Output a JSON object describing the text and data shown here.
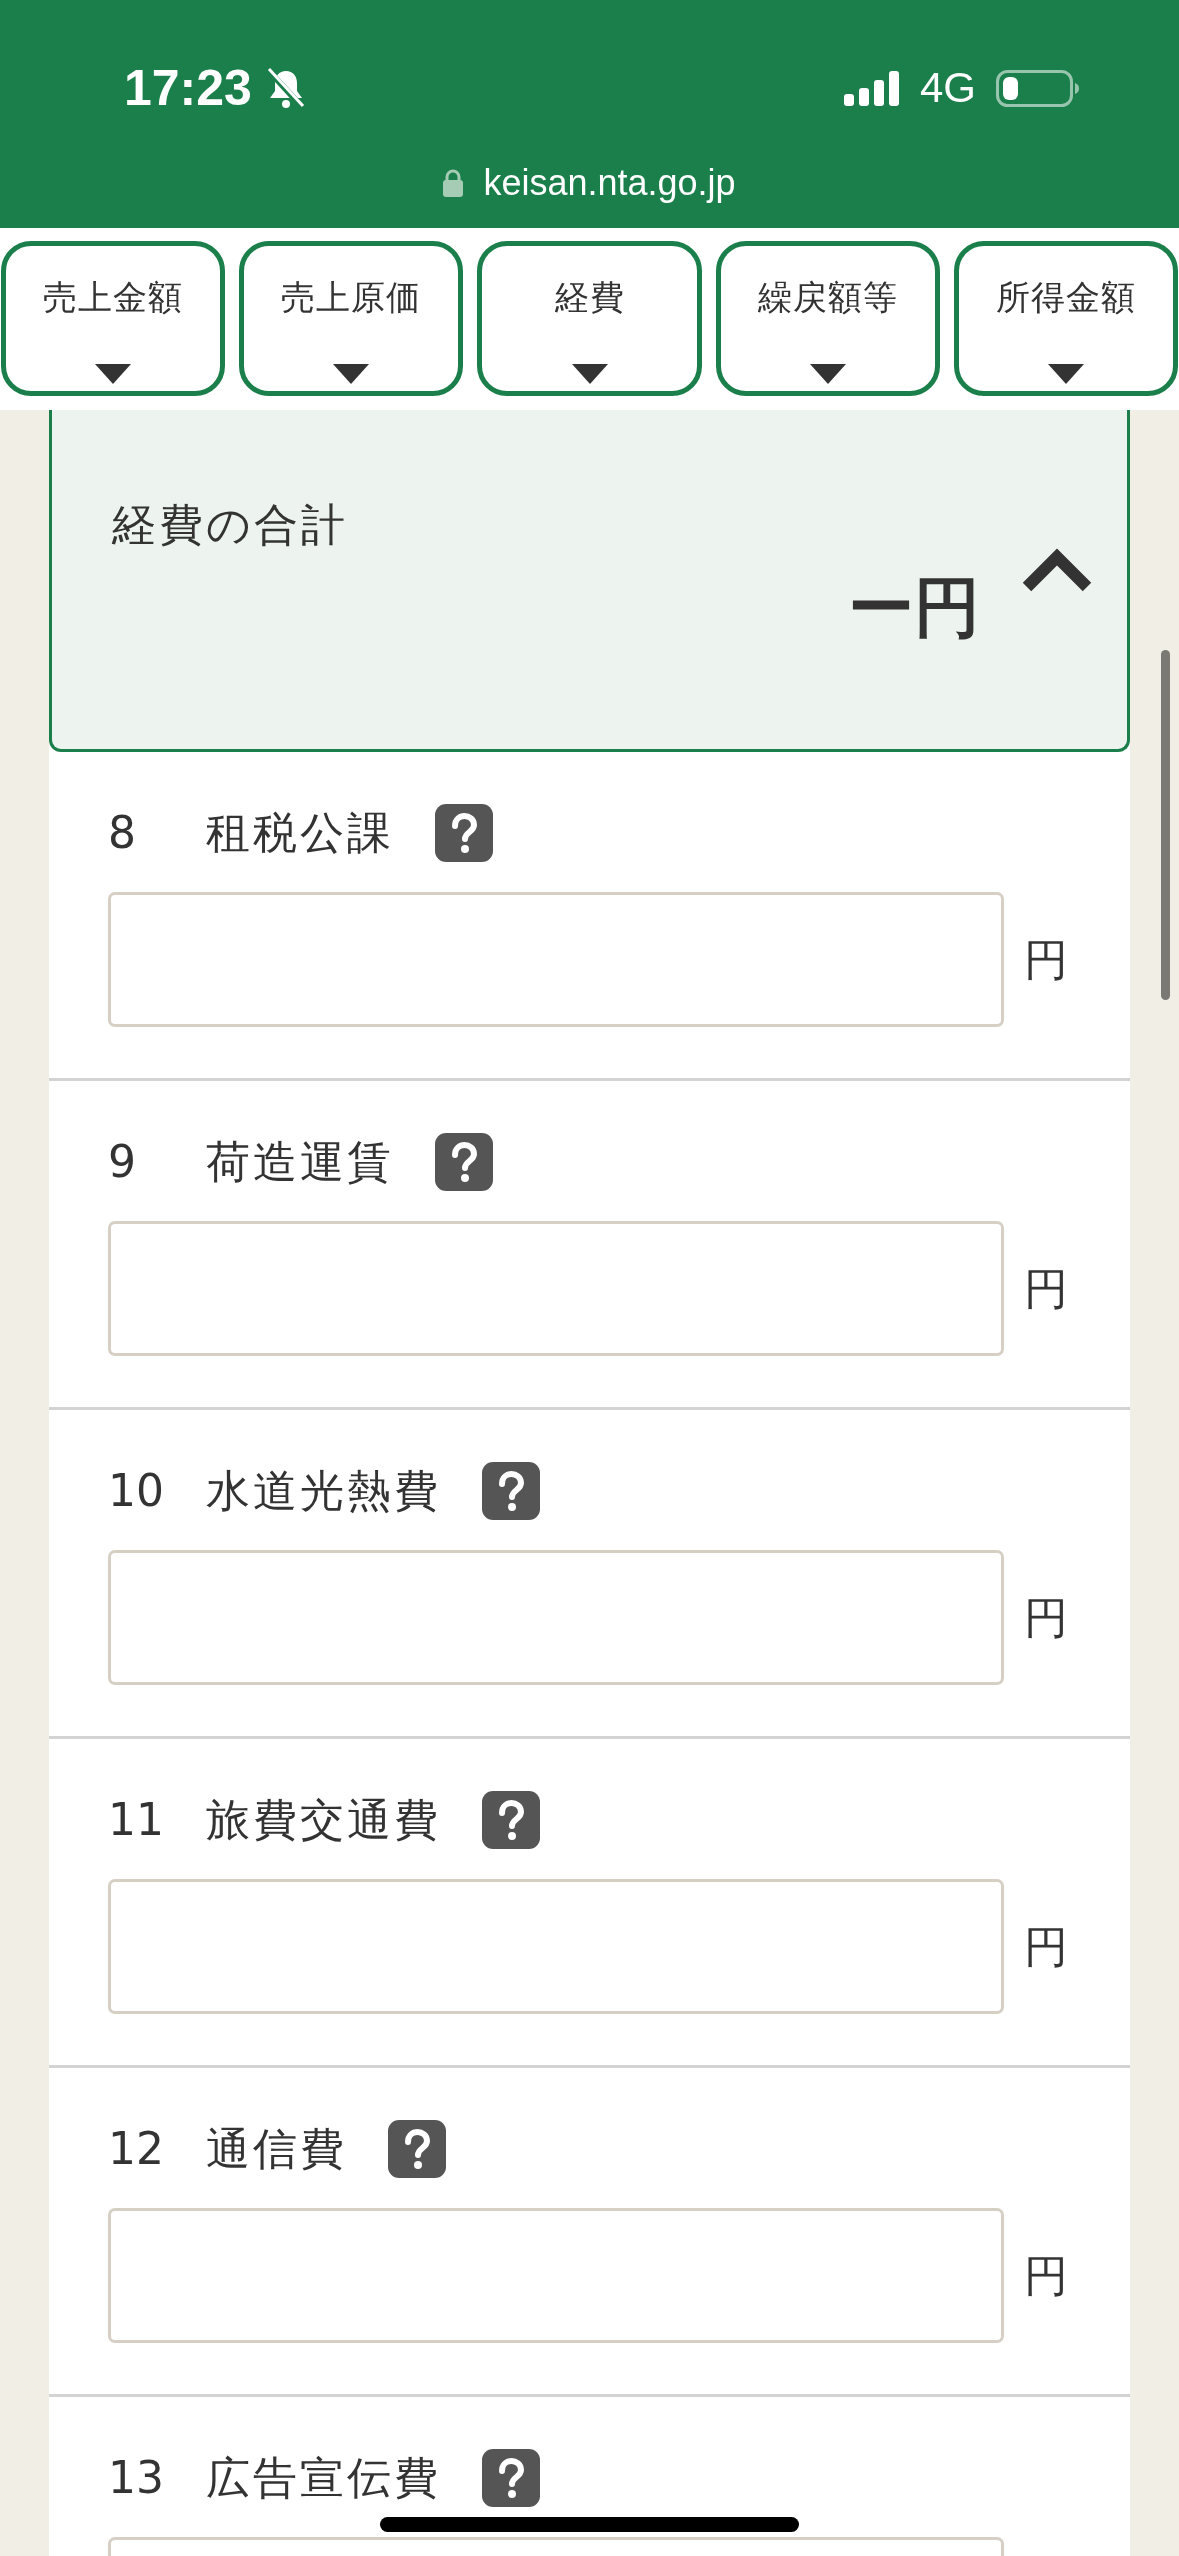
{
  "status_bar": {
    "time": "17:23",
    "network": "4G"
  },
  "address_bar": {
    "url": "keisan.nta.go.jp"
  },
  "section_tabs": [
    {
      "label": "売上金額"
    },
    {
      "label": "売上原価"
    },
    {
      "label": "経費"
    },
    {
      "label": "繰戻額等"
    },
    {
      "label": "所得金額"
    }
  ],
  "summary": {
    "label": "経費の合計",
    "amount": "ー円",
    "expanded": true
  },
  "expense_items": [
    {
      "number": "8",
      "label": "租税公課",
      "unit": "円"
    },
    {
      "number": "9",
      "label": "荷造運賃",
      "unit": "円"
    },
    {
      "number": "10",
      "label": "水道光熱費",
      "unit": "円"
    },
    {
      "number": "11",
      "label": "旅費交通費",
      "unit": "円"
    },
    {
      "number": "12",
      "label": "通信費",
      "unit": "円"
    },
    {
      "number": "13",
      "label": "広告宣伝費"
    }
  ]
}
